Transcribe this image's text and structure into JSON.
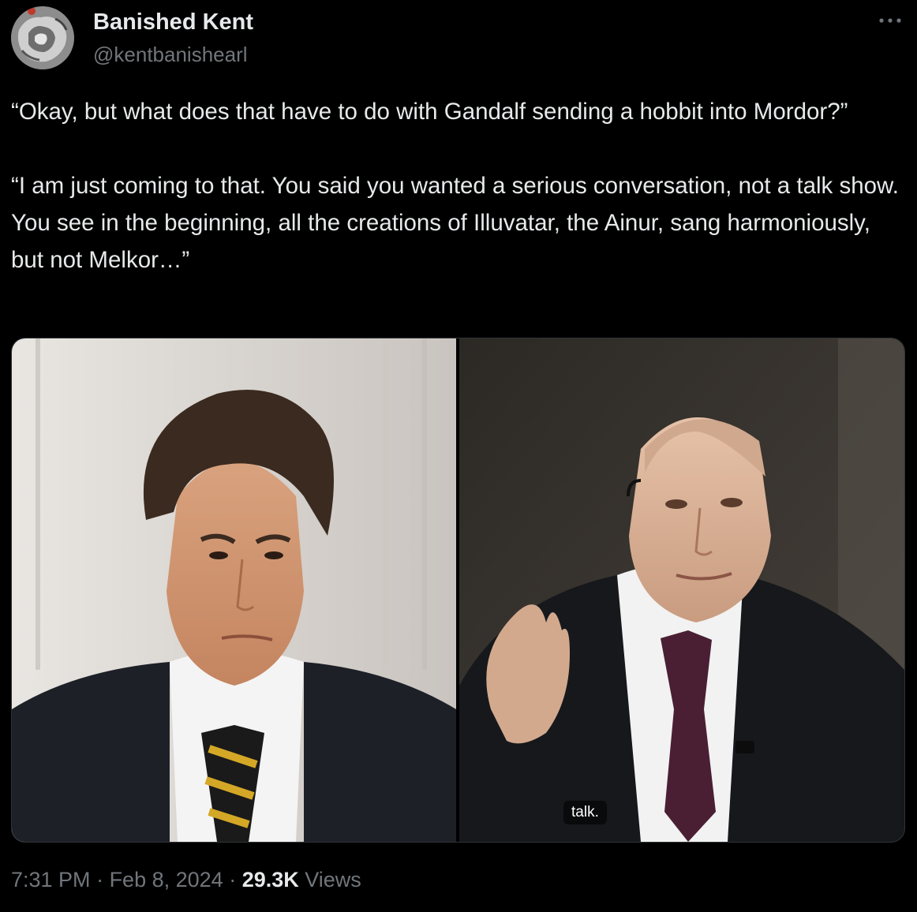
{
  "author": {
    "display_name": "Banished Kent",
    "handle": "@kentbanishearl",
    "avatar_icon": "profile-avatar"
  },
  "more_icon": "more-horizontal-icon",
  "tweet": {
    "text": "“Okay, but what does that have to do with Gandalf sending a hobbit into Mordor?”\n\n“I am just coming to that. You said you wanted a serious conversation, not a talk show. You see in the beginning, all the creations of Illuvatar, the Ainur, sang harmoniously, but not Melkor…”"
  },
  "media": {
    "right_caption": "talk."
  },
  "meta": {
    "time": "7:31 PM",
    "separator": " · ",
    "date": "Feb 8, 2024",
    "views_count": "29.3K",
    "views_label": "Views"
  },
  "colors": {
    "background": "#000000",
    "primary_text": "#e7e9ea",
    "secondary_text": "#71767b",
    "border": "#2f3336"
  }
}
